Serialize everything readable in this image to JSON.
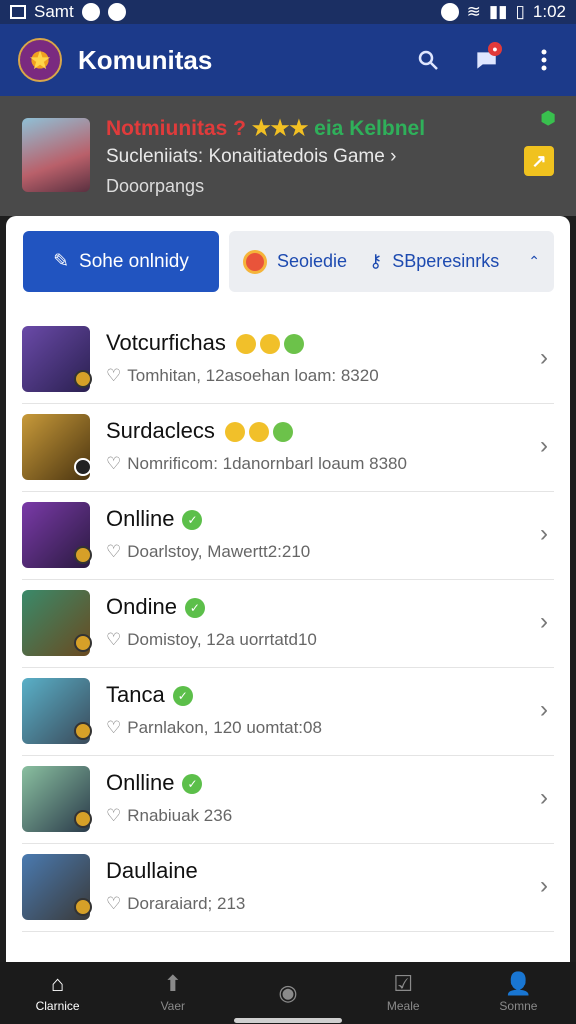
{
  "statusbar": {
    "carrier": "Samt",
    "time": "1:02"
  },
  "appbar": {
    "title": "Komunitas"
  },
  "banner": {
    "title_main": "Notmiunitas ?",
    "title_stars": "★★★",
    "title_tail": "eia Kelbnel",
    "subtitle": "Sucleniiats: Konaitiatedois Game ›",
    "subtitle2": "Dooorpangs"
  },
  "filters": {
    "primary_label": "Sohe onlnidy",
    "secondary_label1": "Seoiedie",
    "secondary_label2": "SBperesinrks"
  },
  "list": [
    {
      "name": "Votcurfichas",
      "meta": "Tomhitan, 12asoehan loam: 8320",
      "avatar_color": "#4b3a8a"
    },
    {
      "name": "Surdaclecs",
      "meta": "Nomrificom: 1danornbarl loaum 8380",
      "avatar_color": "#8a6a2a"
    },
    {
      "name": "Onlline",
      "meta": "Doarlstoy, Mawertt2:210",
      "avatar_color": "#5a3a7a"
    },
    {
      "name": "Ondine",
      "meta": "Domistoy, 12a uorrtatd10",
      "avatar_color": "#6a5a3a"
    },
    {
      "name": "Tanca",
      "meta": "Parnlakon, 120 uomtat:08",
      "avatar_color": "#3a5a7a"
    },
    {
      "name": "Onlline",
      "meta": "Rnabiuak 236",
      "avatar_color": "#2a4a6a"
    },
    {
      "name": "Daullaine",
      "meta": "Doraraiard; 213",
      "avatar_color": "#3a4a5a"
    }
  ],
  "bottomnav": [
    {
      "label": "Clarnice",
      "icon": "home-icon"
    },
    {
      "label": "Vaer",
      "icon": "up-arrow-icon"
    },
    {
      "label": "",
      "icon": "game-icon"
    },
    {
      "label": "Meale",
      "icon": "check-icon"
    },
    {
      "label": "Somne",
      "icon": "profile-icon"
    }
  ]
}
